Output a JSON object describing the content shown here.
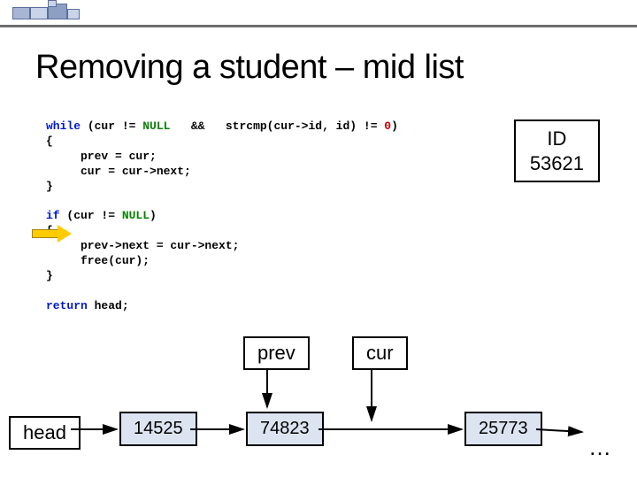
{
  "title": "Removing a student – mid list",
  "id_box": {
    "label": "ID",
    "value": "53621"
  },
  "code_tokens": [
    [
      {
        "t": "while",
        "c": "kw1"
      },
      {
        "t": " (cur != ",
        "c": "id"
      },
      {
        "t": "NULL",
        "c": "kw2"
      },
      {
        "t": "   &&   strcmp(cur->id, id) != ",
        "c": "id"
      },
      {
        "t": "0",
        "c": "num"
      },
      {
        "t": ")",
        "c": "id"
      }
    ],
    [
      {
        "t": "{",
        "c": "id"
      }
    ],
    [
      {
        "t": "     prev = cur;",
        "c": "id"
      }
    ],
    [
      {
        "t": "     cur = cur->next;",
        "c": "id"
      }
    ],
    [
      {
        "t": "}",
        "c": "id"
      }
    ],
    [
      {
        "t": "",
        "c": "id"
      }
    ],
    [
      {
        "t": "if",
        "c": "kw1"
      },
      {
        "t": " (cur != ",
        "c": "id"
      },
      {
        "t": "NULL",
        "c": "kw2"
      },
      {
        "t": ")",
        "c": "id"
      }
    ],
    [
      {
        "t": "{",
        "c": "id"
      }
    ],
    [
      {
        "t": "     prev->next = cur->next;",
        "c": "id"
      }
    ],
    [
      {
        "t": "     free(cur);",
        "c": "id"
      }
    ],
    [
      {
        "t": "}",
        "c": "id"
      }
    ],
    [
      {
        "t": "",
        "c": "id"
      }
    ],
    [
      {
        "t": "return",
        "c": "kw1"
      },
      {
        "t": " head;",
        "c": "id"
      }
    ]
  ],
  "labels": {
    "head": "head",
    "prev": "prev",
    "cur": "cur"
  },
  "nodes": [
    "14525",
    "74823",
    "25773"
  ],
  "ellipsis": "…"
}
